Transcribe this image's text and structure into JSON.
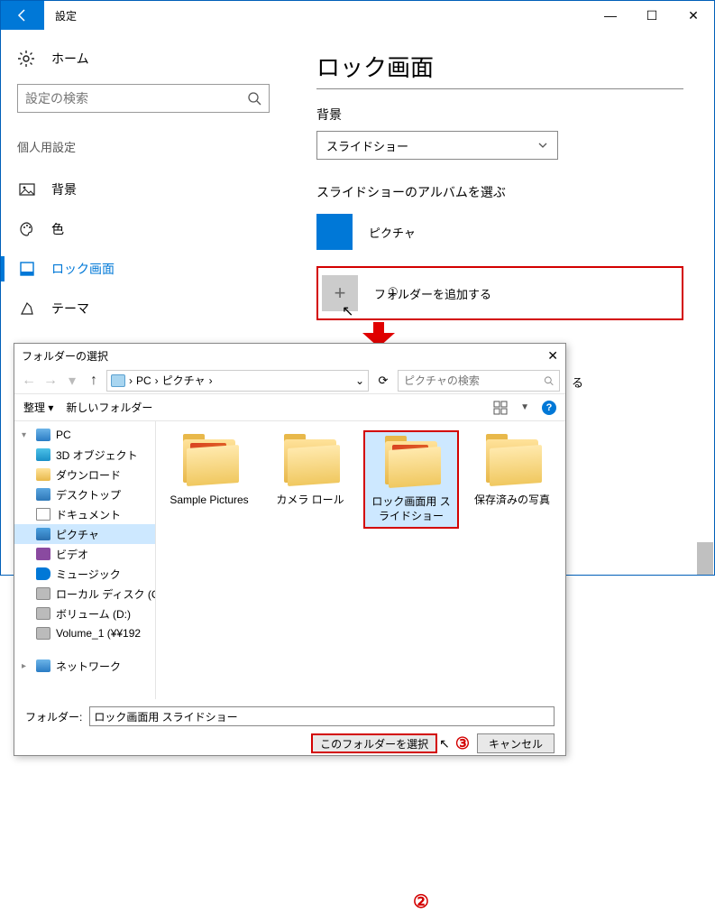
{
  "window": {
    "title": "設定",
    "controls": {
      "min": "—",
      "max": "☐",
      "close": "✕"
    }
  },
  "left": {
    "home": "ホーム",
    "search_placeholder": "設定の検索",
    "section": "個人用設定",
    "items": [
      {
        "label": "背景"
      },
      {
        "label": "色"
      },
      {
        "label": "ロック画面"
      },
      {
        "label": "テーマ"
      }
    ]
  },
  "right": {
    "title": "ロック画面",
    "bg_label": "背景",
    "bg_value": "スライドショー",
    "album_heading": "スライドショーのアルバムを選ぶ",
    "album_pictures": "ピクチャ",
    "add_folder": "フォルダーを追加する"
  },
  "callouts": {
    "one": "①",
    "two": "②",
    "three": "③"
  },
  "side_text": "る",
  "dialog": {
    "title": "フォルダーの選択",
    "breadcrumb": [
      "PC",
      "ピクチャ"
    ],
    "search_placeholder": "ピクチャの検索",
    "toolbar": {
      "organize": "整理",
      "newfolder": "新しいフォルダー"
    },
    "tree": [
      {
        "label": "PC",
        "icon": "pc",
        "indent": false,
        "caret": "▾"
      },
      {
        "label": "3D オブジェクト",
        "icon": "cube",
        "indent": true
      },
      {
        "label": "ダウンロード",
        "icon": "folder",
        "indent": true
      },
      {
        "label": "デスクトップ",
        "icon": "desktop",
        "indent": true
      },
      {
        "label": "ドキュメント",
        "icon": "doc",
        "indent": true
      },
      {
        "label": "ピクチャ",
        "icon": "pic",
        "indent": true,
        "selected": true
      },
      {
        "label": "ビデオ",
        "icon": "vid",
        "indent": true
      },
      {
        "label": "ミュージック",
        "icon": "mus",
        "indent": true
      },
      {
        "label": "ローカル ディスク (C",
        "icon": "disk",
        "indent": true
      },
      {
        "label": "ボリューム (D:)",
        "icon": "disk",
        "indent": true
      },
      {
        "label": "Volume_1 (¥¥192",
        "icon": "disk",
        "indent": true
      },
      {
        "label": "ネットワーク",
        "icon": "net",
        "indent": false,
        "caret": "▸"
      }
    ],
    "folders": [
      {
        "label": "Sample Pictures",
        "photo": true
      },
      {
        "label": "カメラ ロール",
        "photo": false
      },
      {
        "label": "ロック画面用 スライドショー",
        "photo": true,
        "selected": true
      },
      {
        "label": "保存済みの写真",
        "photo": false
      }
    ],
    "footer": {
      "folder_label": "フォルダー:",
      "folder_value": "ロック画面用 スライドショー",
      "select": "このフォルダーを選択",
      "cancel": "キャンセル"
    }
  }
}
